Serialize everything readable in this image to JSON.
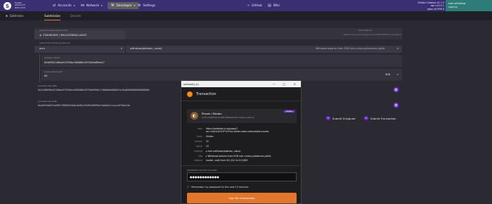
{
  "topbar": {
    "logo_glyph": "S",
    "chain": {
      "line1": "Shiden",
      "line2": "shiden/73",
      "line3": "#471,473"
    },
    "nav": [
      {
        "icon": "arrows-icon",
        "glyph": "⇄",
        "label": "Accounts"
      },
      {
        "icon": "network-icon",
        "glyph": "⋈",
        "label": "Network"
      },
      {
        "icon": "developer-icon",
        "glyph": "⚒",
        "label": "Developer"
      },
      {
        "icon": "gear-icon",
        "glyph": "⚙",
        "label": "Settings"
      }
    ],
    "links": [
      {
        "icon": "branch-icon",
        "glyph": "⑂",
        "label": "GitHub"
      },
      {
        "icon": "book-icon",
        "glyph": "▤",
        "label": "Wiki"
      }
    ],
    "node": {
      "line1": "Shiden Collator v5.7.0",
      "line2": "api v10.0.1",
      "line3": "apps v0.999.0"
    },
    "account": {
      "name": "icon.withdraw",
      "sub": "signing"
    }
  },
  "subtabs": [
    {
      "glyph": "⎈",
      "label": "Extrinsics"
    },
    {
      "label": "Submission"
    },
    {
      "label": "Decode"
    }
  ],
  "form": {
    "using_label": "using the selected account",
    "account_glyph": "◉",
    "account_value": "STAKING6DE | WALLEXENDALLIANCE",
    "balance_label": "free balance",
    "balance_value": "balancing.yes.Shopping.ex.scentMarketPlan.ms.gilian.x",
    "submit_label": "submit the following extrinsic",
    "pallet": "evm",
    "call": "withdraw(address, value)",
    "call_desc": "Withdraw balance from EVM into currency/balances pallet.",
    "address_label": "address: H160",
    "address_value": "0x9d9561108ae975936ec585086c59736e9d89ed17",
    "value_label": "value: BalanceOf",
    "value_value": "80",
    "unit": "SDN",
    "encoded_data_label": "encoded call data",
    "encoded_data_value": "0x3c00049dc61108ae972936ec5850086c59736d99d6c1700000a0008423c3ba00000000000000000",
    "encoded_hash_label": "encoded call hash",
    "encoded_hash_value": "0xe6526d5b71e090770689f63e8cde58c4f0391b9699ef4e0ddcfcceccd3f3bdf4e",
    "copy_glyph": "⧉",
    "btn_unsigned": "Submit Unsigned",
    "btn_transaction": "Submit Transaction"
  },
  "popup": {
    "window_title": "polkadot{.js}",
    "ctrl_min": "—",
    "ctrl_max": "□",
    "ctrl_close": "✕",
    "plugin_glyph": "○",
    "title": "Transaction",
    "account_glyph": "◐",
    "account_name": "Planet / Shiden",
    "account_address": "5c67m9Y96ECMuUpxE9f7M8PK9Z2fjN7ncMAzjucJdMKou4",
    "account_badge": "Shiden",
    "rows": [
      {
        "k": "from",
        "v": "https://polkadot.js.org/apps/?"
      },
      {
        "k": "",
        "v": "rpc=wss%3A%2F%2Frpc.shiden.astar.network#/accounts"
      },
      {
        "k": "chain",
        "v": "Shiden"
      },
      {
        "k": "version",
        "v": "31"
      },
      {
        "k": "nonce",
        "v": "15"
      },
      {
        "k": "method",
        "v": "▸ evm.withdraw(address, value)"
      },
      {
        "k": "info",
        "v": "▸ Withdraw balance from EVM into currency/balances pallet."
      },
      {
        "k": "lifetime",
        "v": "mortal, valid from 411,411 to 413,663"
      }
    ],
    "pw_label": "PASSWORD FOR THIS ACCOUNT",
    "pw_value": "●●●●●●●●●●●●",
    "remember_glyph": "✔",
    "remember_label": "Remember my password for the next 15 minutes",
    "sign_label": "Sign the transaction"
  }
}
